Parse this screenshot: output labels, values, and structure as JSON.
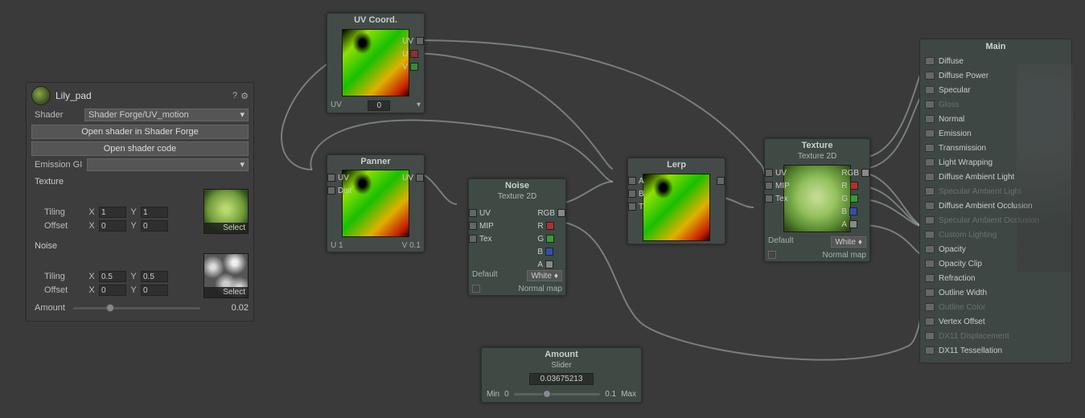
{
  "inspector": {
    "material_name": "Lily_pad",
    "shader_label": "Shader",
    "shader_value": "Shader Forge/UV_motion",
    "open_in_forge": "Open shader in Shader Forge",
    "open_code": "Open shader code",
    "emission_gi": "Emission GI",
    "texture_label": "Texture",
    "noise_label": "Noise",
    "tiling": "Tiling",
    "offset": "Offset",
    "x": "X",
    "y": "Y",
    "tex_tiling_x": "1",
    "tex_tiling_y": "1",
    "tex_offset_x": "0",
    "tex_offset_y": "0",
    "noise_tiling_x": "0.5",
    "noise_tiling_y": "0.5",
    "noise_offset_x": "0",
    "noise_offset_y": "0",
    "select": "Select",
    "amount_label": "Amount",
    "amount_value": "0.02"
  },
  "nodes": {
    "uvcoord": {
      "title": "UV Coord.",
      "out_uv": "UV",
      "out_u": "U",
      "out_v": "V",
      "foot_label": "UV",
      "foot_val": "0"
    },
    "panner": {
      "title": "Panner",
      "in_uv": "UV",
      "in_dist": "Dist",
      "out_uv": "UV",
      "foot_u": "U 1",
      "foot_v": "V 0.1"
    },
    "noise": {
      "title": "Noise",
      "sub": "Texture 2D",
      "in_uv": "UV",
      "in_mip": "MIP",
      "in_tex": "Tex",
      "out_rgb": "RGB",
      "out_r": "R",
      "out_g": "G",
      "out_b": "B",
      "out_a": "A",
      "default": "Default",
      "white": "White",
      "normal": "Normal map"
    },
    "lerp": {
      "title": "Lerp",
      "in_a": "A",
      "in_b": "B",
      "in_t": "T"
    },
    "texture": {
      "title": "Texture",
      "sub": "Texture 2D",
      "in_uv": "UV",
      "in_mip": "MIP",
      "in_tex": "Tex",
      "out_rgb": "RGB",
      "out_r": "R",
      "out_g": "G",
      "out_b": "B",
      "out_a": "A",
      "default": "Default",
      "white": "White",
      "normal": "Normal map"
    },
    "amount": {
      "title": "Amount",
      "sub": "Slider",
      "value": "0.03675213",
      "min_label": "Min",
      "min": "0",
      "max": "0.1",
      "max_label": "Max"
    }
  },
  "main": {
    "title": "Main",
    "rows": [
      {
        "label": "Diffuse",
        "dim": false
      },
      {
        "label": "Diffuse Power",
        "dim": false
      },
      {
        "label": "Specular",
        "dim": false
      },
      {
        "label": "Gloss",
        "dim": true
      },
      {
        "label": "Normal",
        "dim": false
      },
      {
        "label": "Emission",
        "dim": false
      },
      {
        "label": "Transmission",
        "dim": false
      },
      {
        "label": "Light Wrapping",
        "dim": false
      },
      {
        "label": "Diffuse Ambient Light",
        "dim": false
      },
      {
        "label": "Specular Ambient Light",
        "dim": true
      },
      {
        "label": "Diffuse Ambient Occlusion",
        "dim": false
      },
      {
        "label": "Specular Ambient Occlusion",
        "dim": true
      },
      {
        "label": "Custom Lighting",
        "dim": true
      },
      {
        "label": "Opacity",
        "dim": false
      },
      {
        "label": "Opacity Clip",
        "dim": false
      },
      {
        "label": "Refraction",
        "dim": false
      },
      {
        "label": "Outline Width",
        "dim": false
      },
      {
        "label": "Outline Color",
        "dim": true
      },
      {
        "label": "Vertex Offset",
        "dim": false
      },
      {
        "label": "DX11 Displacement",
        "dim": true
      },
      {
        "label": "DX11 Tessellation",
        "dim": false
      }
    ]
  }
}
